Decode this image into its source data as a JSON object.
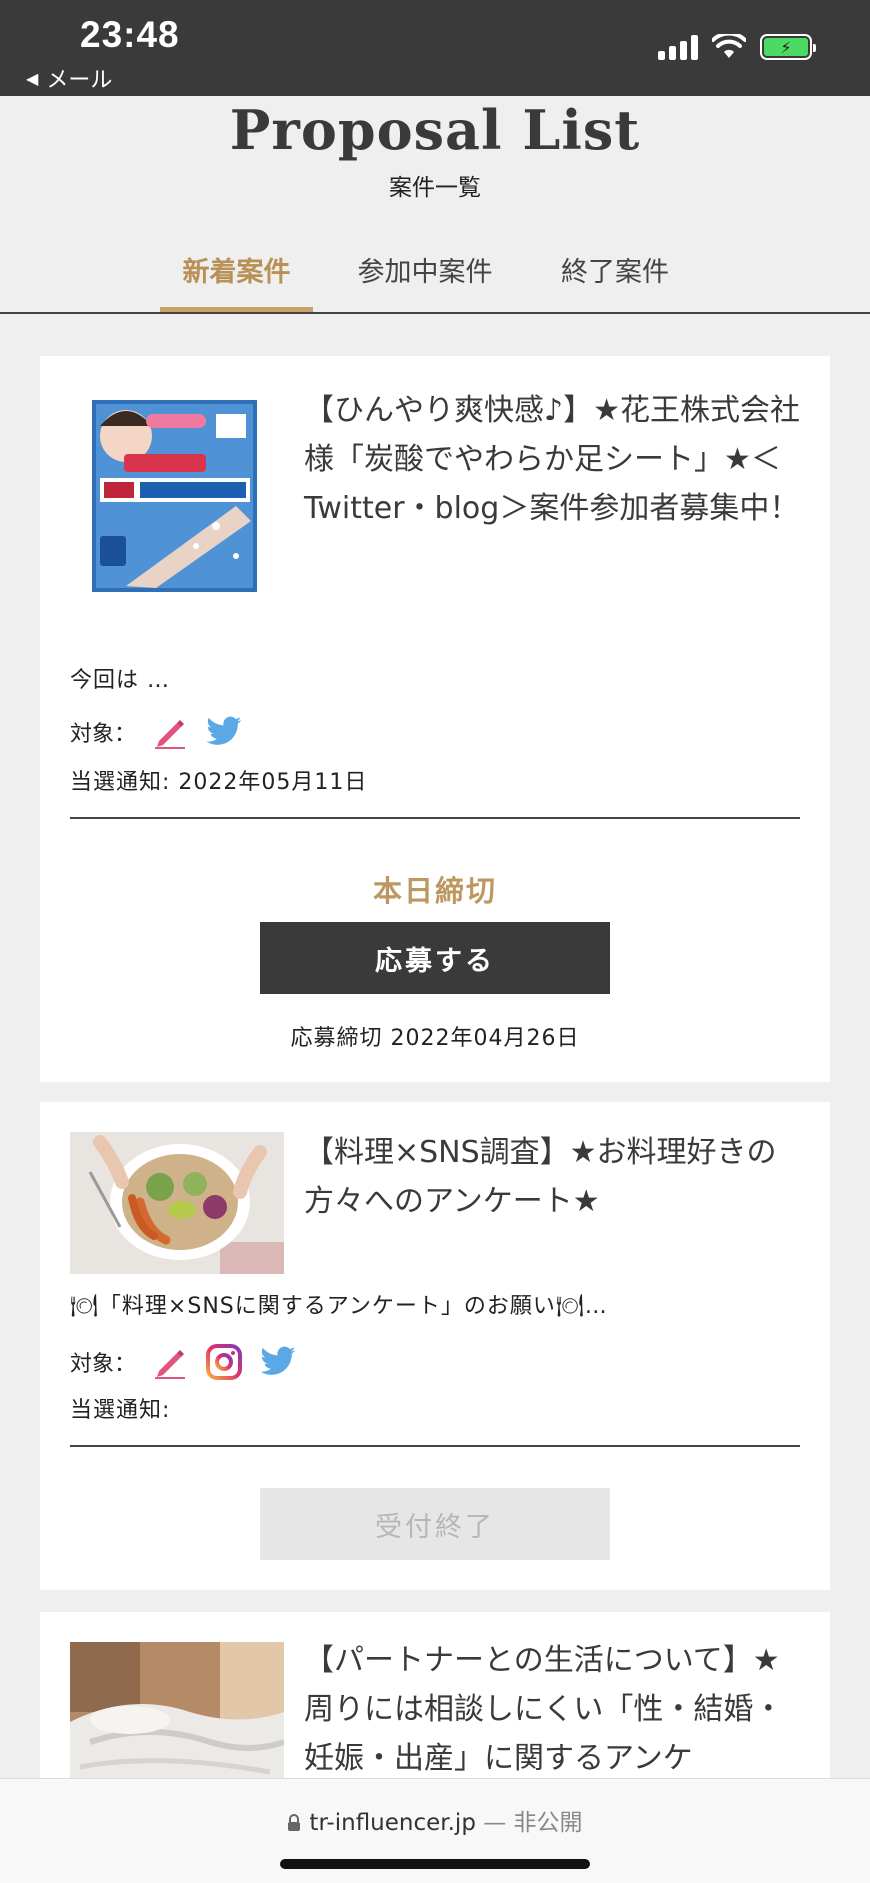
{
  "status_bar": {
    "time": "23:48",
    "back_label": "メール"
  },
  "header": {
    "title": "Proposal List",
    "subtitle": "案件一覧"
  },
  "tabs": [
    {
      "label": "新着案件",
      "active": true
    },
    {
      "label": "参加中案件",
      "active": false
    },
    {
      "label": "終了案件",
      "active": false
    }
  ],
  "cards": [
    {
      "title": "【ひんやり爽快感♪】★花王株式会社様「炭酸でやわらか足シート」★＜Twitter・blog＞案件参加者募集中！",
      "excerpt": "今回は …",
      "target_label": "対象：",
      "targets": [
        "pencil-icon",
        "twitter-icon"
      ],
      "notify_label": "当選通知: 2022年05月11日",
      "deadline_badge": "本日締切",
      "button_label": "応募する",
      "deadline_text": "応募締切 2022年04月26日"
    },
    {
      "title": "【料理×SNS調査】★お料理好きの方々へのアンケート★",
      "excerpt": "🍽「料理×SNSに関するアンケート」のお願い🍽…",
      "target_label": "対象：",
      "targets": [
        "pencil-icon",
        "instagram-icon",
        "twitter-icon"
      ],
      "notify_label": "当選通知:",
      "button_label": "受付終了"
    },
    {
      "title": "【パートナーとの生活について】★周りには相談しにくい「性・結婚・妊娠・出産」に関するアンケ"
    }
  ],
  "url_bar": {
    "domain": "tr-influencer.jp",
    "status": "— 非公開"
  },
  "colors": {
    "accent": "#b99157",
    "dark": "#3a3a3a",
    "twitter": "#5aa9e6",
    "pencil": "#e0557e"
  }
}
